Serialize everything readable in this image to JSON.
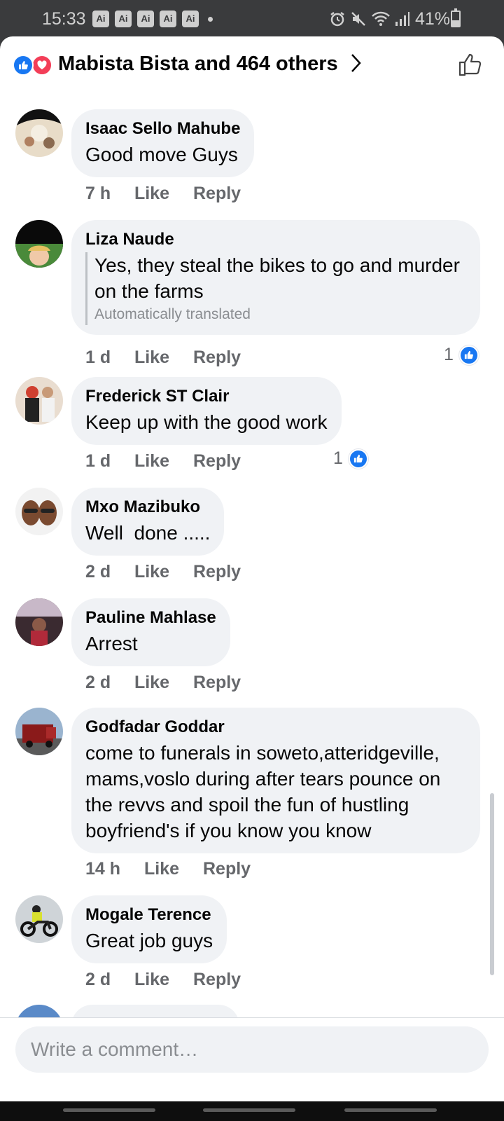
{
  "status_bar": {
    "time": "15:33",
    "ai_badges": [
      "Ai",
      "Ai",
      "Ai",
      "Ai",
      "Ai"
    ],
    "battery": "41%",
    "battery_level": 0.41,
    "icons": [
      "alarm-icon",
      "mute-icon",
      "wifi-icon",
      "signal-icon",
      "battery-icon"
    ]
  },
  "reactions_header": {
    "text": "Mabista Bista and 464 others",
    "reaction_icons": [
      "like-reaction-icon",
      "love-reaction-icon"
    ]
  },
  "comments": [
    {
      "author": "Isaac Sello Mahube",
      "text": "Good move Guys",
      "time": "7 h",
      "like": "Like",
      "reply": "Reply"
    },
    {
      "author": "Liza Naude",
      "text": "Yes, they steal the bikes to go and murder on the farms",
      "translation_note": "Automatically translated",
      "time": "1 d",
      "like": "Like",
      "reply": "Reply",
      "likes": "1"
    },
    {
      "author": "Frederick ST Clair",
      "text": "Keep up with the good work",
      "time": "1 d",
      "like": "Like",
      "reply": "Reply",
      "likes": "1"
    },
    {
      "author": "Mxo Mazibuko",
      "text": "Well  done .....",
      "time": "2 d",
      "like": "Like",
      "reply": "Reply"
    },
    {
      "author": "Pauline Mahlase",
      "text": "Arrest",
      "time": "2 d",
      "like": "Like",
      "reply": "Reply"
    },
    {
      "author": "Godfadar Goddar",
      "text": "come to funerals in soweto,atteridgeville, mams,voslo during after tears pounce on the revvs and spoil the fun of hustling boyfriend's if you know you know",
      "time": "14 h",
      "like": "Like",
      "reply": "Reply"
    },
    {
      "author": "Mogale Terence",
      "text": "Great job guys",
      "time": "2 d",
      "like": "Like",
      "reply": "Reply"
    }
  ],
  "composer": {
    "placeholder": "Write a comment…"
  },
  "colors": {
    "brand_blue": "#1877f2",
    "love_red": "#f33e58",
    "bubble": "#f0f2f5",
    "secondary_text": "#65676b"
  }
}
